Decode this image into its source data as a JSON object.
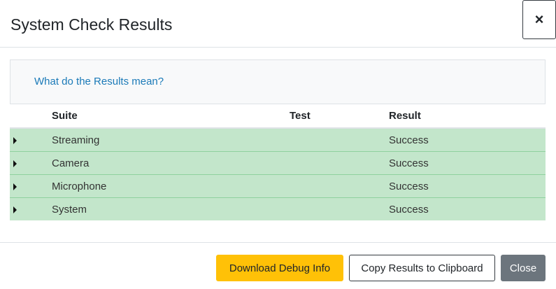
{
  "header": {
    "title": "System Check Results",
    "close_symbol": "×"
  },
  "info": {
    "link_text": "What do the Results mean?"
  },
  "table": {
    "columns": [
      "",
      "Suite",
      "Test",
      "Result"
    ],
    "rows": [
      {
        "suite": "Streaming",
        "test": "",
        "result": "Success"
      },
      {
        "suite": "Camera",
        "test": "",
        "result": "Success"
      },
      {
        "suite": "Microphone",
        "test": "",
        "result": "Success"
      },
      {
        "suite": "System",
        "test": "",
        "result": "Success"
      }
    ],
    "row_color": "#c3e6cb",
    "expand_icon": "caret-right-icon"
  },
  "footer": {
    "debug_label": "Download Debug Info",
    "copy_label": "Copy Results to Clipboard",
    "close_label": "Close"
  },
  "colors": {
    "warning": "#ffc107",
    "secondary": "#6c757d",
    "link": "#1b7ab8"
  }
}
